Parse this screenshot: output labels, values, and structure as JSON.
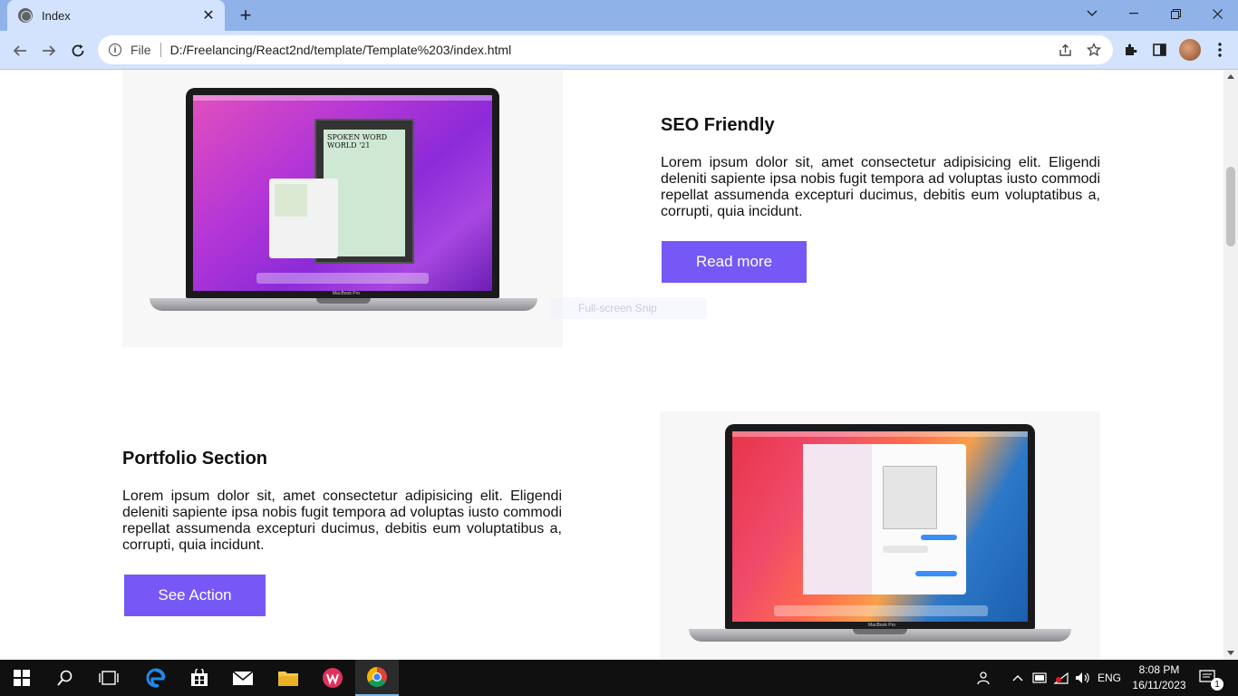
{
  "browser": {
    "tab_title": "Index",
    "omnibox_scheme": "File",
    "omnibox_url": "D:/Freelancing/React2nd/template/Template%203/index.html"
  },
  "sections": [
    {
      "title": "SEO Friendly",
      "body": "Lorem ipsum dolor sit, amet consectetur adipisicing elit. Eligendi deleniti sapiente ipsa nobis fugit tempora ad voluptas iusto commodi repellat assumenda excepturi ducimus, debitis eum voluptatibus a, corrupti, quia incidunt.",
      "button": "Read more"
    },
    {
      "title": "Portfolio Section",
      "body": "Lorem ipsum dolor sit, amet consectetur adipisicing elit. Eligendi deleniti sapiente ipsa nobis fugit tempora ad voluptas iusto commodi repellat assumenda excepturi ducimus, debitis eum voluptatibus a, corrupti, quia incidunt.",
      "button": "See Action"
    }
  ],
  "ghost_overlay": "Full-screen Snip",
  "laptop_brand": "MacBook Pro",
  "laptop_poster_text": "SPOKEN WORD WORLD '21",
  "taskbar": {
    "lang": "ENG",
    "time": "8:08 PM",
    "date": "16/11/2023",
    "notification_count": "1"
  },
  "colors": {
    "accent": "#7558f5",
    "chrome_tab_bar": "#8fb2e8",
    "chrome_toolbar": "#d3e3fd"
  }
}
